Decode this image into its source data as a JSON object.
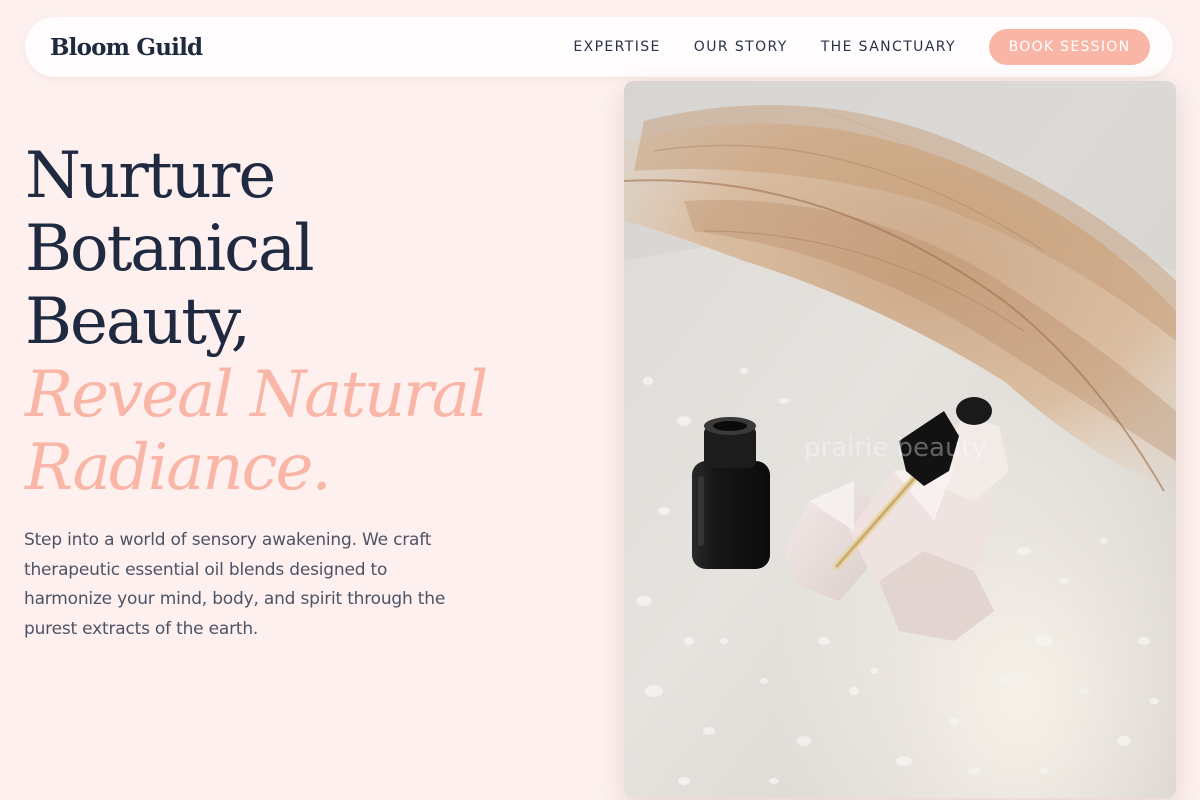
{
  "brand": {
    "name": "Bloom Guild"
  },
  "nav": {
    "links": [
      "EXPERTISE",
      "OUR STORY",
      "THE SANCTUARY"
    ],
    "cta": "BOOK SESSION"
  },
  "hero": {
    "title_lines": [
      "Nurture",
      "Botanical",
      "Beauty,"
    ],
    "accent_lines": [
      "Reveal Natural",
      "Radiance."
    ],
    "description": "Step into a world of sensory awakening. We craft therapeutic essential oil blends designed to harmonize your mind, body, and spirit through the purest extracts of the earth.",
    "image_watermark": "prairie beauty"
  },
  "colors": {
    "page_bg": "#fdf0ee",
    "navbar_bg": "#fefcfc",
    "accent": "#f9b5a6",
    "text_dark": "#1f2940",
    "text_body": "#4d5366"
  }
}
